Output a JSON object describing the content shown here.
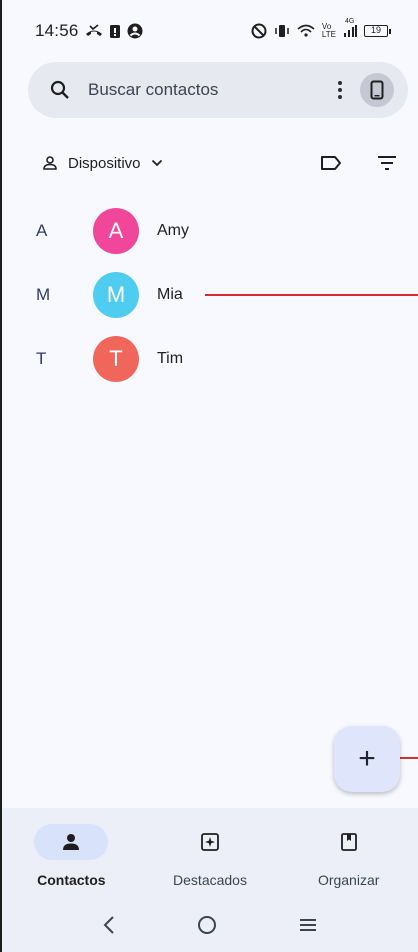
{
  "status_bar": {
    "time": "14:56",
    "lte_top": "Vo",
    "lte_bottom": "LTE",
    "network_type": "4G",
    "battery_level": "19"
  },
  "search": {
    "placeholder": "Buscar contactos"
  },
  "filter": {
    "account_label": "Dispositivo"
  },
  "contacts": [
    {
      "section": "A",
      "initial": "A",
      "name": "Amy",
      "color": "#f0479b"
    },
    {
      "section": "M",
      "initial": "M",
      "name": "Mia",
      "color": "#4ecdf0"
    },
    {
      "section": "T",
      "initial": "T",
      "name": "Tim",
      "color": "#f0665a"
    }
  ],
  "fab": {
    "symbol": "+"
  },
  "bottom_nav": {
    "tabs": [
      {
        "label": "Contactos",
        "icon": "person-icon",
        "active": true
      },
      {
        "label": "Destacados",
        "icon": "star-sparkle-icon",
        "active": false
      },
      {
        "label": "Organizar",
        "icon": "bookmark-book-icon",
        "active": false
      }
    ]
  },
  "colors": {
    "accent_line": "#d32f2f",
    "search_bg": "#e7e9f1",
    "nav_bg": "#eceff7",
    "active_pill": "#d8e2fb"
  }
}
